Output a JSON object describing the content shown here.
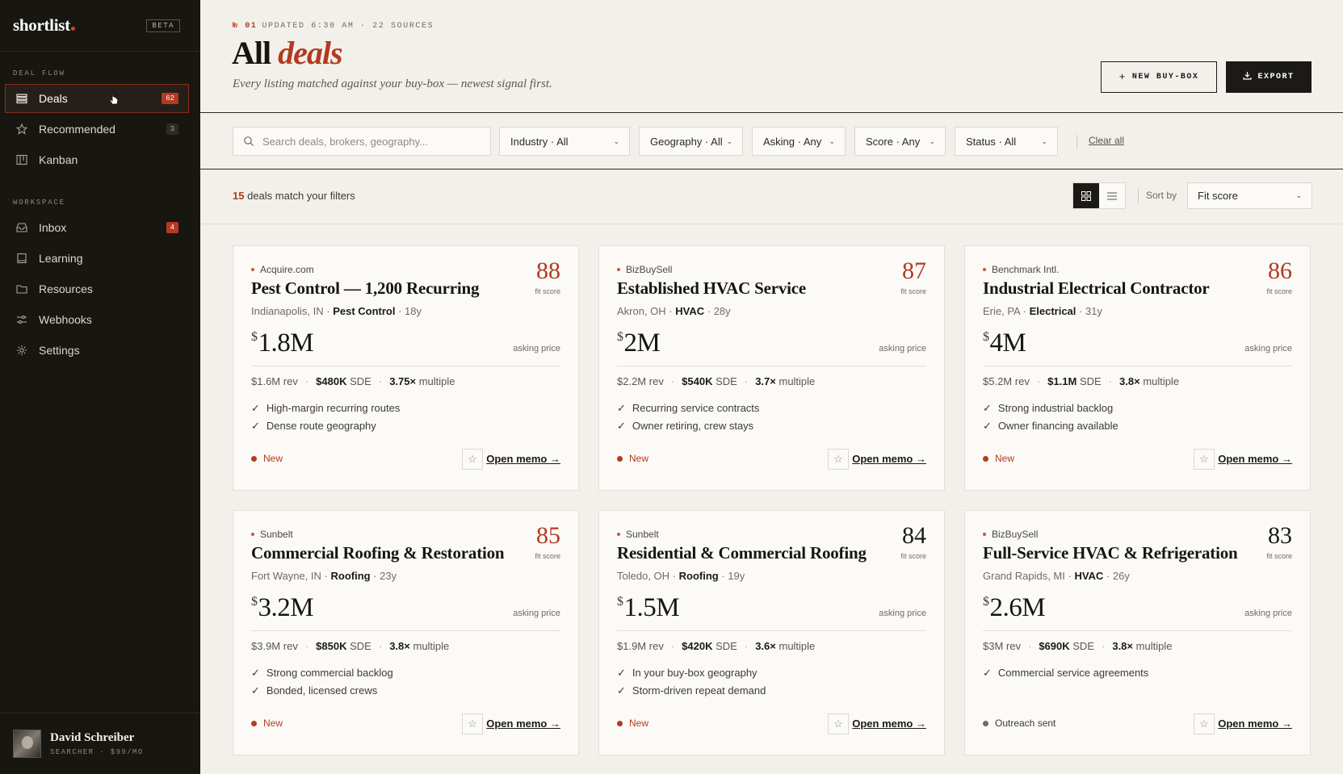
{
  "brand": {
    "name": "shortlist",
    "tag": "BETA"
  },
  "sidebar": {
    "deal_flow_title": "DEAL FLOW",
    "deal_flow": [
      {
        "label": "Deals",
        "badge": "62",
        "icon": "deals-list-icon"
      },
      {
        "label": "Recommended",
        "badge": "3",
        "icon": "star-icon"
      },
      {
        "label": "Kanban",
        "badge": "",
        "icon": "kanban-icon"
      }
    ],
    "workspace_title": "WORKSPACE",
    "workspace": [
      {
        "label": "Inbox",
        "badge": "4",
        "icon": "inbox-icon"
      },
      {
        "label": "Learning",
        "icon": "book-icon"
      },
      {
        "label": "Resources",
        "icon": "folder-icon"
      },
      {
        "label": "Webhooks",
        "icon": "webhook-icon"
      },
      {
        "label": "Settings",
        "icon": "gear-icon"
      }
    ],
    "user": {
      "name": "David Schreiber",
      "role": "SEARCHER · $99/MO"
    }
  },
  "header": {
    "number": "№ 01",
    "meta": "UPDATED 6:30 AM · 22 SOURCES",
    "title_plain": "All",
    "title_emph": "deals",
    "subtitle": "Every listing matched against your buy-box — newest signal first.",
    "new_buybox": "NEW BUY-BOX",
    "export": "EXPORT"
  },
  "filters": {
    "search_placeholder": "Search deals, brokers, geography...",
    "industry": "Industry · All",
    "geography": "Geography · All",
    "asking": "Asking · Any",
    "score": "Score · Any",
    "status": "Status · All",
    "clear": "Clear all"
  },
  "results": {
    "count": "15",
    "count_text": "deals match your filters",
    "sort_label": "Sort by",
    "sort_value": "Fit score"
  },
  "card_labels": {
    "fit": "fit score",
    "asking": "asking price",
    "open": "Open memo →",
    "rev": "rev",
    "sde": "SDE",
    "multiple": "multiple"
  },
  "colors": {
    "accent": "#b33a20",
    "sidebar": "#181611",
    "page": "#f2f0eb"
  },
  "deals": [
    {
      "source": "Acquire.com",
      "score": "88",
      "name": "Pest Control — 1,200 Recurring",
      "city": "Indianapolis, IN",
      "industry": "Pest Control",
      "age": "18y",
      "price": "1.8M",
      "rev": "$1.6M",
      "sde": "$480K",
      "multiple": "3.75×",
      "checks": [
        "High-margin recurring routes",
        "Dense route geography"
      ],
      "status": "New"
    },
    {
      "source": "BizBuySell",
      "score": "87",
      "name": "Established HVAC Service",
      "city": "Akron, OH",
      "industry": "HVAC",
      "age": "28y",
      "price": "2M",
      "rev": "$2.2M",
      "sde": "$540K",
      "multiple": "3.7×",
      "checks": [
        "Recurring service contracts",
        "Owner retiring, crew stays"
      ],
      "status": "New"
    },
    {
      "source": "Benchmark Intl.",
      "score": "86",
      "name": "Industrial Electrical Contractor",
      "city": "Erie, PA",
      "industry": "Electrical",
      "age": "31y",
      "price": "4M",
      "rev": "$5.2M",
      "sde": "$1.1M",
      "multiple": "3.8×",
      "checks": [
        "Strong industrial backlog",
        "Owner financing available"
      ],
      "status": "New"
    },
    {
      "source": "Sunbelt",
      "score": "85",
      "name": "Commercial Roofing & Restoration",
      "city": "Fort Wayne, IN",
      "industry": "Roofing",
      "age": "23y",
      "price": "3.2M",
      "rev": "$3.9M",
      "sde": "$850K",
      "multiple": "3.8×",
      "checks": [
        "Strong commercial backlog",
        "Bonded, licensed crews"
      ],
      "status": "New"
    },
    {
      "source": "Sunbelt",
      "score": "84",
      "name": "Residential & Commercial Roofing",
      "city": "Toledo, OH",
      "industry": "Roofing",
      "age": "19y",
      "price": "1.5M",
      "rev": "$1.9M",
      "sde": "$420K",
      "multiple": "3.6×",
      "checks": [
        "In your buy-box geography",
        "Storm-driven repeat demand"
      ],
      "status": "New"
    },
    {
      "source": "BizBuySell",
      "score": "83",
      "name": "Full-Service HVAC & Refrigeration",
      "city": "Grand Rapids, MI",
      "industry": "HVAC",
      "age": "26y",
      "price": "2.6M",
      "rev": "$3M",
      "sde": "$690K",
      "multiple": "3.8×",
      "checks": [
        "Commercial service agreements"
      ],
      "status": "Outreach sent"
    }
  ]
}
